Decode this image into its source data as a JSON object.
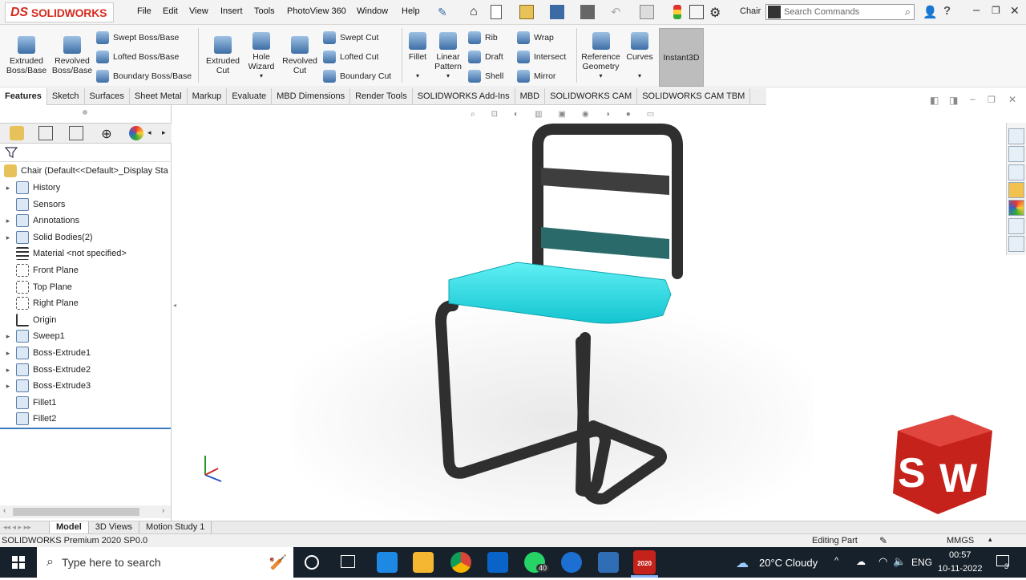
{
  "app": {
    "logo_text": "SOLIDWORKS",
    "document_name": "Chair"
  },
  "menu": [
    "File",
    "Edit",
    "View",
    "Insert",
    "Tools",
    "PhotoView 360",
    "Window",
    "Help"
  ],
  "search": {
    "placeholder": "Search Commands"
  },
  "ribbon": {
    "extruded_boss": "Extruded Boss/Base",
    "revolved_boss": "Revolved Boss/Base",
    "swept_boss": "Swept Boss/Base",
    "lofted_boss": "Lofted Boss/Base",
    "boundary_boss": "Boundary Boss/Base",
    "extruded_cut": "Extruded Cut",
    "hole_wizard": "Hole Wizard",
    "revolved_cut": "Revolved Cut",
    "swept_cut": "Swept Cut",
    "lofted_cut": "Lofted Cut",
    "boundary_cut": "Boundary Cut",
    "fillet": "Fillet",
    "linear_pattern": "Linear Pattern",
    "rib": "Rib",
    "draft": "Draft",
    "shell": "Shell",
    "wrap": "Wrap",
    "intersect": "Intersect",
    "mirror": "Mirror",
    "reference_geometry": "Reference Geometry",
    "curves": "Curves",
    "instant3d": "Instant3D"
  },
  "tabs": [
    "Features",
    "Sketch",
    "Surfaces",
    "Sheet Metal",
    "Markup",
    "Evaluate",
    "MBD Dimensions",
    "Render Tools",
    "SOLIDWORKS Add-Ins",
    "MBD",
    "SOLIDWORKS CAM",
    "SOLIDWORKS CAM TBM"
  ],
  "tree": {
    "root": "Chair  (Default<<Default>_Display Sta",
    "items": [
      "History",
      "Sensors",
      "Annotations",
      "Solid Bodies(2)",
      "Material <not specified>",
      "Front Plane",
      "Top Plane",
      "Right Plane",
      "Origin",
      "Sweep1",
      "Boss-Extrude1",
      "Boss-Extrude2",
      "Boss-Extrude3",
      "Fillet1",
      "Fillet2"
    ]
  },
  "bottom_tabs": [
    "Model",
    "3D Views",
    "Motion Study 1"
  ],
  "status": {
    "left": "SOLIDWORKS Premium 2020 SP0.0",
    "mode": "Editing Part",
    "units": "MMGS"
  },
  "taskbar": {
    "search_placeholder": "Type here to search",
    "weather": "20°C  Cloudy",
    "lang": "ENG",
    "time": "00:57",
    "date": "10-11-2022",
    "whatsapp_badge": "40",
    "notif_count": "3",
    "sw_year": "2020"
  },
  "colors": {
    "seat": "#2de0e8",
    "frame": "#3a3a3a",
    "brand_red": "#d52b1e"
  }
}
